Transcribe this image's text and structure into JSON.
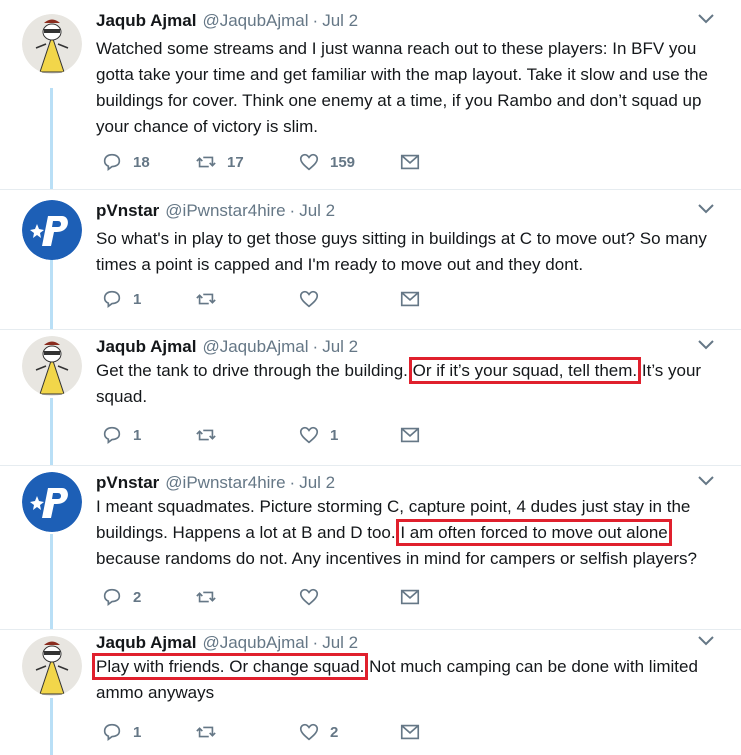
{
  "tweets": [
    {
      "name": "Jaqub Ajmal",
      "handle": "@JaqubAjmal",
      "date": "Jul 2",
      "avatar": "cartoon-avatar",
      "text_before": "Watched some streams and I just wanna reach out to these players: In BFV you gotta take your time and get familiar with the map layout. Take it slow and use the buildings for cover. Think one enemy at a time, if you Rambo and don’t squad up your chance of victory is slim.",
      "text_hl": "",
      "text_after": "",
      "replies": "18",
      "retweets": "17",
      "likes": "159"
    },
    {
      "name": "pVnstar",
      "handle": "@iPwnstar4hire",
      "date": "Jul 2",
      "avatar": "p-logo-avatar",
      "text_before": "So what's in play to get those guys sitting in buildings at C to move out? So many times a point is capped and I'm ready to move out and they dont.",
      "text_hl": "",
      "text_after": "",
      "replies": "1",
      "retweets": "",
      "likes": ""
    },
    {
      "name": "Jaqub Ajmal",
      "handle": "@JaqubAjmal",
      "date": "Jul 2",
      "avatar": "cartoon-avatar",
      "text_before": "Get the tank to drive through  the building. ",
      "text_hl": "Or if it’s your squad, tell them.",
      "text_after": " It’s your squad.",
      "replies": "1",
      "retweets": "",
      "likes": "1"
    },
    {
      "name": "pVnstar",
      "handle": "@iPwnstar4hire",
      "date": "Jul 2",
      "avatar": "p-logo-avatar",
      "text_before": "I meant squadmates. Picture storming C, capture point, 4 dudes just stay in the buildings. Happens a lot at B and D too. ",
      "text_hl": "I am often forced to move out alone",
      "text_after": " because randoms do not. Any incentives in mind for campers or selfish players?",
      "replies": "2",
      "retweets": "",
      "likes": ""
    },
    {
      "name": "Jaqub Ajmal",
      "handle": "@JaqubAjmal",
      "date": "Jul 2",
      "avatar": "cartoon-avatar",
      "text_before": "",
      "text_hl": "Play with friends. Or change squad.",
      "text_after": " Not much camping can be done with limited ammo anyways",
      "replies": "1",
      "retweets": "",
      "likes": "2"
    }
  ],
  "colors": {
    "thread_line": "#b9dff6",
    "highlight_box": "#e0202d",
    "muted_text": "#657786",
    "p_logo_bg": "#1d5fb6"
  }
}
